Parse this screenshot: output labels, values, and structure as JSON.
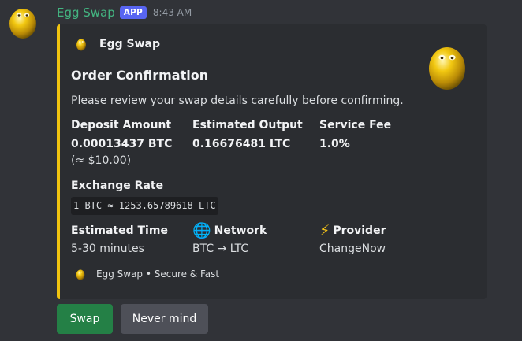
{
  "message": {
    "bot_name": "Egg Swap",
    "badge": "APP",
    "timestamp": "8:43 AM",
    "avatar_icon": "golden-egg-icon"
  },
  "embed": {
    "accent_color": "#f1c40f",
    "author": "Egg Swap",
    "title": "Order Confirmation",
    "description": "Please review your swap details carefully before confirming.",
    "fields": {
      "deposit": {
        "name": "Deposit Amount",
        "value": "0.00013437 BTC",
        "subvalue": "(≈ $10.00)"
      },
      "output": {
        "name": "Estimated Output",
        "value": "0.16676481 LTC"
      },
      "fee": {
        "name": "Service Fee",
        "value": "1.0%"
      },
      "rate": {
        "name": "Exchange Rate",
        "value": "1 BTC ≈ 1253.65789618 LTC"
      },
      "time": {
        "name": "Estimated Time",
        "value": "5-30 minutes"
      },
      "network": {
        "name": "Network",
        "icon": "🌐",
        "value": "BTC → LTC"
      },
      "provider": {
        "name": "Provider",
        "icon": "⚡",
        "value": "ChangeNow"
      }
    },
    "footer": "Egg Swap • Secure & Fast"
  },
  "buttons": {
    "swap": "Swap",
    "cancel": "Never mind"
  }
}
